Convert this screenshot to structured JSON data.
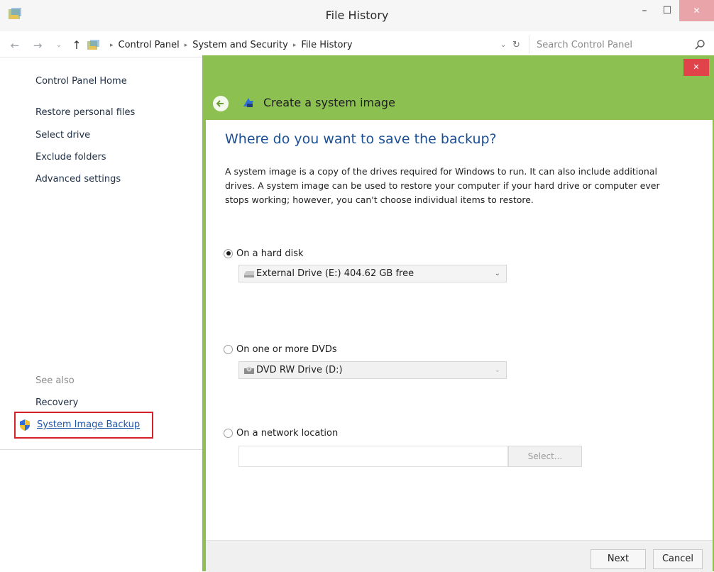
{
  "window": {
    "title": "File History",
    "controls": {
      "minimize": "–",
      "maximize": "☐",
      "close": "✕"
    }
  },
  "address_bar": {
    "back_glyph": "←",
    "forward_glyph": "→",
    "recent_glyph": "⌄",
    "up_glyph": "↑",
    "breadcrumb": [
      "Control Panel",
      "System and Security",
      "File History"
    ],
    "separator": "▸",
    "dropdown_glyph": "⌄",
    "refresh_glyph": "↻",
    "search_placeholder": "Search Control Panel"
  },
  "left_pane": {
    "home": "Control Panel Home",
    "links": [
      "Restore personal files",
      "Select drive",
      "Exclude folders",
      "Advanced settings"
    ],
    "see_also_heading": "See also",
    "see_also": [
      "Recovery",
      "System Image Backup"
    ]
  },
  "wizard": {
    "close_glyph": "✕",
    "title": "Create a system image",
    "heading": "Where do you want to save the backup?",
    "description": "A system image is a copy of the drives required for Windows to run. It can also include additional drives. A system image can be used to restore your computer if your hard drive or computer ever stops working; however, you can't choose individual items to restore.",
    "options": {
      "hard_disk": {
        "label": "On a hard disk",
        "selected": true,
        "value": "External Drive (E:)  404.62 GB free"
      },
      "dvd": {
        "label": "On one or more DVDs",
        "selected": false,
        "value": "DVD RW Drive (D:)"
      },
      "network": {
        "label": "On a network location",
        "selected": false,
        "value": "",
        "select_button": "Select..."
      }
    },
    "select_arrow": "⌄",
    "buttons": {
      "next": "Next",
      "cancel": "Cancel"
    }
  },
  "colors": {
    "wizard_accent": "#8cc152",
    "heading_blue": "#1a4f96",
    "highlight_red": "#d6212a",
    "link_blue": "#1f56a8"
  }
}
